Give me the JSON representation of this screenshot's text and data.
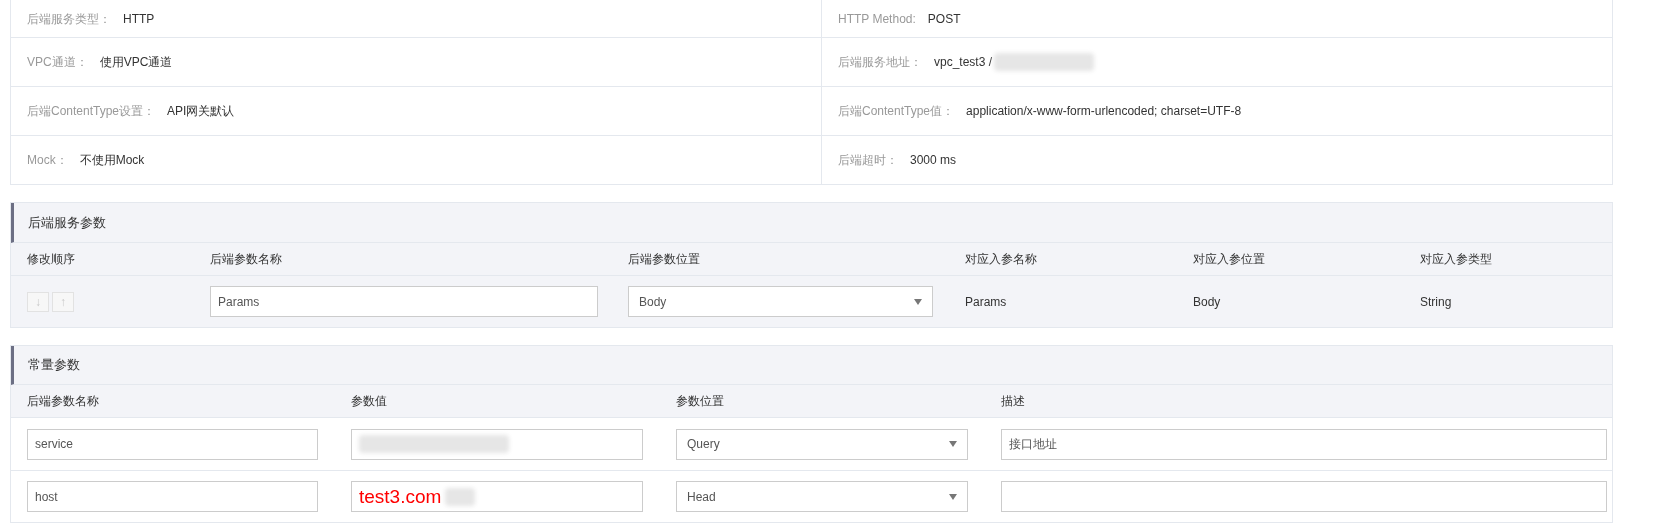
{
  "info_rows": [
    {
      "left": {
        "label": "后端服务类型：",
        "value": "HTTP"
      },
      "right": {
        "label": "HTTP Method:",
        "value": "POST"
      }
    },
    {
      "left": {
        "label": "VPC通道：",
        "value": "使用VPC通道"
      },
      "right": {
        "label": "后端服务地址：",
        "value": "vpc_test3 /",
        "redacted": true
      }
    },
    {
      "left": {
        "label": "后端ContentType设置：",
        "value": "API网关默认"
      },
      "right": {
        "label": "后端ContentType值：",
        "value": "application/x-www-form-urlencoded; charset=UTF-8"
      }
    },
    {
      "left": {
        "label": "Mock：",
        "value": "不使用Mock"
      },
      "right": {
        "label": "后端超时：",
        "value": "3000 ms"
      }
    }
  ],
  "backend_params": {
    "title": "后端服务参数",
    "columns": [
      "修改顺序",
      "后端参数名称",
      "后端参数位置",
      "对应入参名称",
      "对应入参位置",
      "对应入参类型"
    ],
    "rows": [
      {
        "order_buttons": [
          {
            "label": "↓",
            "disabled": true
          },
          {
            "label": "↑",
            "disabled": true
          }
        ],
        "name": "Params",
        "position": "Body",
        "input_name": "Params",
        "input_position": "Body",
        "input_type": "String"
      }
    ]
  },
  "constant_params": {
    "title": "常量参数",
    "columns": [
      "后端参数名称",
      "参数值",
      "参数位置",
      "描述"
    ],
    "rows": [
      {
        "name": "service",
        "redacted": true,
        "position": "Query",
        "description": "接口地址"
      },
      {
        "name": "host",
        "value": "test3.com",
        "redacted": true,
        "position": "Head"
      }
    ]
  }
}
